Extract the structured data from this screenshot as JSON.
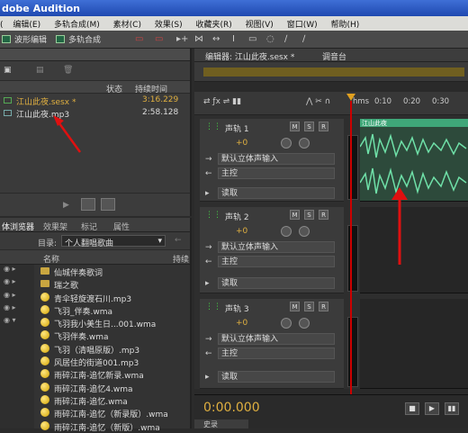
{
  "titlebar": {
    "title": "dobe Audition"
  },
  "menubar": {
    "items": [
      "(",
      "编辑(E)",
      "多轨合成(M)",
      "素材(C)",
      "效果(S)",
      "收藏夹(R)",
      "视图(V)",
      "窗口(W)",
      "帮助(H)"
    ]
  },
  "toolbar": {
    "waveform_label": "波形编辑",
    "multitrack_label": "多轨合成"
  },
  "files": {
    "columns": {
      "status": "状态",
      "duration": "持续时间"
    },
    "rows": [
      {
        "name": "江山此夜.sesx *",
        "duration": "3:16.229"
      },
      {
        "name": "江山此夜.mp3",
        "duration": "2:58.128"
      }
    ]
  },
  "browser": {
    "tabs": [
      "体浏览器",
      "效果架",
      "标记",
      "属性"
    ],
    "dir_label": "目录:",
    "dir_value": "个人翻唱歌曲",
    "col_name": "名称",
    "col_duration": "持续",
    "items": [
      {
        "name": "仙城伴奏歌词",
        "folder": true
      },
      {
        "name": "瑞之歌",
        "folder": true
      },
      {
        "name": "青伞轻旋渡石川.mp3"
      },
      {
        "name": "飞羽_伴奏.wma"
      },
      {
        "name": "飞羽我小美生日...001.wma"
      },
      {
        "name": "飞羽伴奏.wma"
      },
      {
        "name": "飞羽（清唱原版）.mp3"
      },
      {
        "name": "风居住的街道001.mp3"
      },
      {
        "name": "雨碎江南-追忆新录.wma"
      },
      {
        "name": "雨碎江南-追忆4.wma"
      },
      {
        "name": "雨碎江南-追忆.wma"
      },
      {
        "name": "雨碎江南-追忆（新录版）.wma"
      },
      {
        "name": "雨碎江南-追忆（新版）.wma"
      }
    ]
  },
  "editor": {
    "tabs": [
      "编辑器: 江山此夜.sesx *",
      "调音台"
    ],
    "ruler": [
      "hms",
      "0:10",
      "0:20",
      "0:30"
    ],
    "tracks": [
      {
        "name": "声轨 1",
        "volume": "+0",
        "input": "默认立体声输入",
        "output": "主控",
        "read": "读取"
      },
      {
        "name": "声轨 2",
        "volume": "+0",
        "input": "默认立体声输入",
        "output": "主控",
        "read": "读取"
      },
      {
        "name": "声轨 3",
        "volume": "+0",
        "input": "默认立体声输入",
        "output": "主控",
        "read": "读取"
      }
    ],
    "clip_label": "江山此夜",
    "m": "M",
    "s": "S",
    "r": "R",
    "timecode": "0:00.000"
  },
  "bottom": {
    "left_tab": "史录"
  }
}
